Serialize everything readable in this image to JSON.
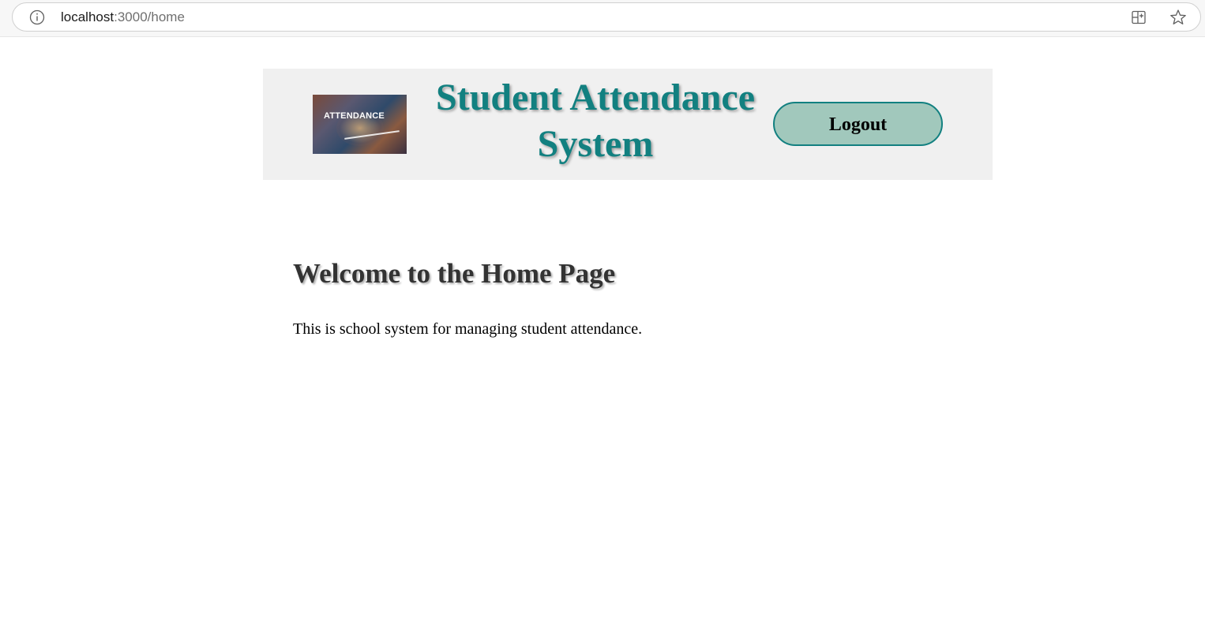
{
  "browser": {
    "url_host": "localhost",
    "url_path": ":3000/home",
    "icons": {
      "info": "info-icon",
      "split_screen": "split-screen-icon",
      "favorite": "star-icon"
    }
  },
  "header": {
    "logo_text": "ATTENDANCE",
    "title": "Student Attendance System",
    "logout_label": "Logout"
  },
  "main": {
    "heading": "Welcome to the Home Page",
    "description": "This is school system for managing student attendance."
  },
  "colors": {
    "title": "#128080",
    "header_background": "#f0f0f0",
    "logout_fill": "#a1c8bc",
    "logout_border": "#128080",
    "heading": "#333333"
  }
}
